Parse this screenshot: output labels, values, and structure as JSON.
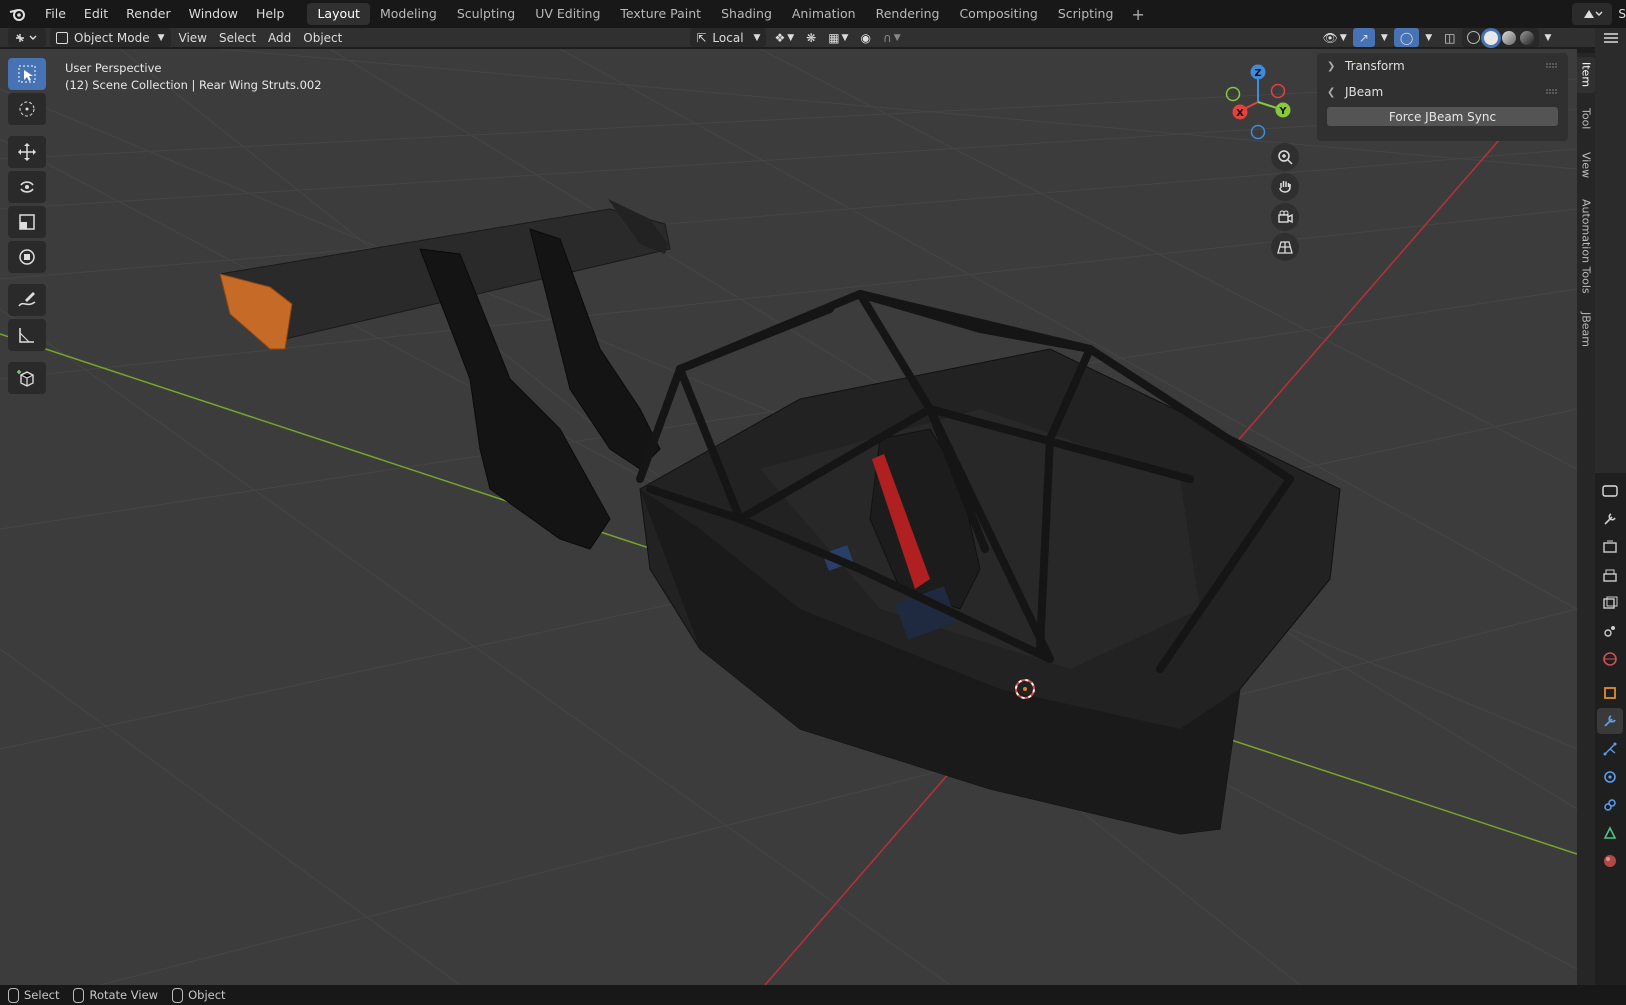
{
  "menu": [
    "File",
    "Edit",
    "Render",
    "Window",
    "Help"
  ],
  "workspaces": [
    "Layout",
    "Modeling",
    "Sculpting",
    "UV Editing",
    "Texture Paint",
    "Shading",
    "Animation",
    "Rendering",
    "Compositing",
    "Scripting"
  ],
  "active_workspace": "Layout",
  "scene_label": "S",
  "header": {
    "mode": "Object Mode",
    "menus": [
      "View",
      "Select",
      "Add",
      "Object"
    ],
    "orientation": "Local"
  },
  "viewport": {
    "line1": "User Perspective",
    "line2": "(12) Scene Collection | Rear Wing Struts.002"
  },
  "gizmo": {
    "z": "Z",
    "x": "X",
    "y": "Y"
  },
  "npanel": {
    "transform_label": "Transform",
    "jbeam_label": "JBeam",
    "sync_button": "Force JBeam Sync"
  },
  "sidebar_tabs": [
    "Item",
    "Tool",
    "View",
    "Automation Tools",
    "JBeam"
  ],
  "status": {
    "select": "Select",
    "rotate": "Rotate View",
    "object": "Object"
  },
  "colors": {
    "accent": "#4772b3",
    "x_axis": "#e8403f",
    "y_axis": "#8bc73b",
    "z_axis": "#3f8cdf",
    "wing_endplate": "#c66a28"
  }
}
